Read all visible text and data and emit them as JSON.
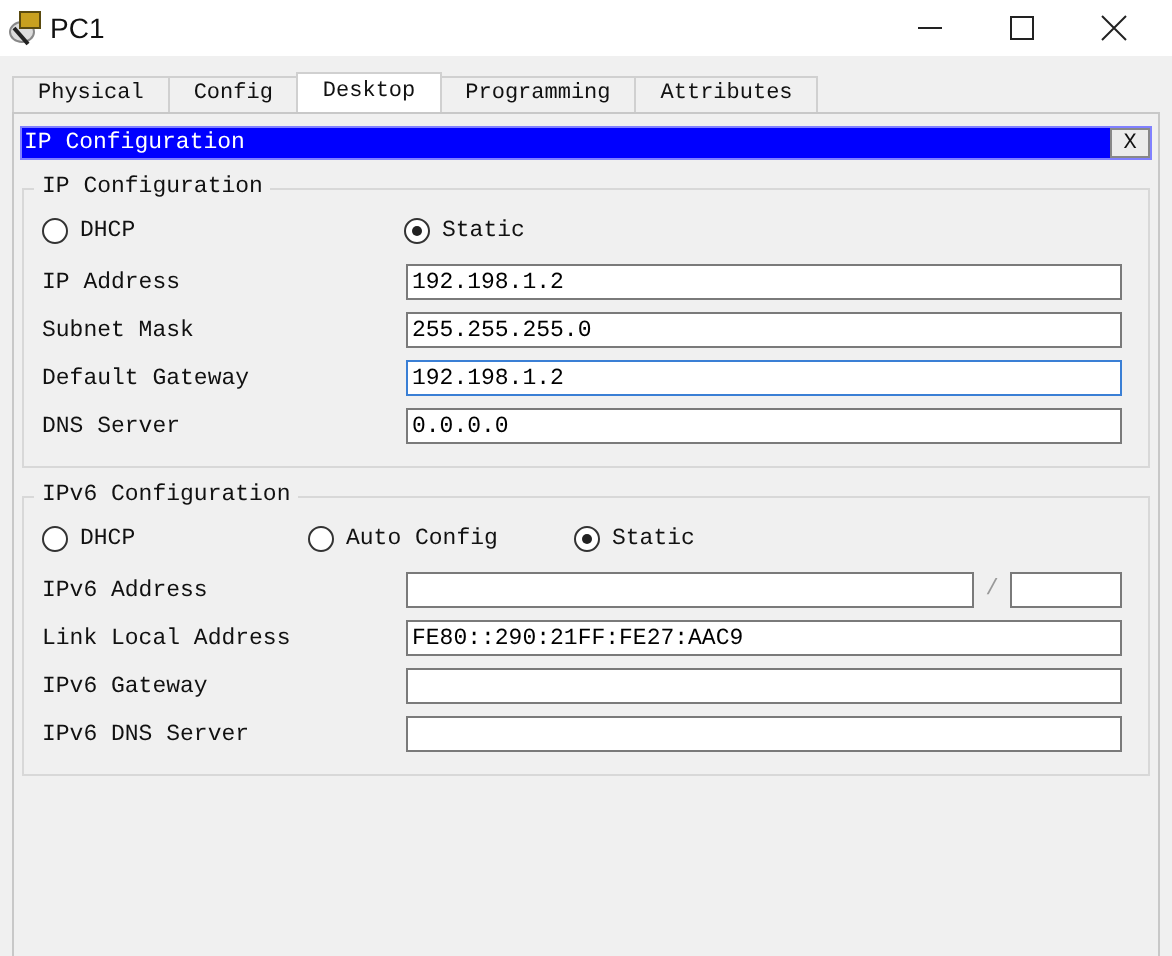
{
  "window": {
    "title": "PC1"
  },
  "tabs": [
    {
      "label": "Physical",
      "selected": false
    },
    {
      "label": "Config",
      "selected": false
    },
    {
      "label": "Desktop",
      "selected": true
    },
    {
      "label": "Programming",
      "selected": false
    },
    {
      "label": "Attributes",
      "selected": false
    }
  ],
  "panel": {
    "title": "IP Configuration",
    "close": "X"
  },
  "ipv4": {
    "title": "IP Configuration",
    "modes": [
      {
        "label": "DHCP",
        "selected": false
      },
      {
        "label": "Static",
        "selected": true
      }
    ],
    "fields": [
      {
        "label": "IP Address",
        "value": "192.198.1.2",
        "focused": false
      },
      {
        "label": "Subnet Mask",
        "value": "255.255.255.0",
        "focused": false
      },
      {
        "label": "Default Gateway",
        "value": "192.198.1.2",
        "focused": true
      },
      {
        "label": "DNS Server",
        "value": "0.0.0.0",
        "focused": false
      }
    ]
  },
  "ipv6": {
    "title": "IPv6 Configuration",
    "modes": [
      {
        "label": "DHCP",
        "selected": false
      },
      {
        "label": "Auto Config",
        "selected": false
      },
      {
        "label": "Static",
        "selected": true
      }
    ],
    "fields": [
      {
        "label": "IPv6 Address",
        "kind": "prefix",
        "separator": "/"
      },
      {
        "label": "Link Local Address",
        "kind": "plain",
        "value": "FE80::290:21FF:FE27:AAC9"
      },
      {
        "label": "IPv6 Gateway",
        "kind": "plain"
      },
      {
        "label": "IPv6 DNS Server",
        "kind": "plain"
      }
    ]
  }
}
